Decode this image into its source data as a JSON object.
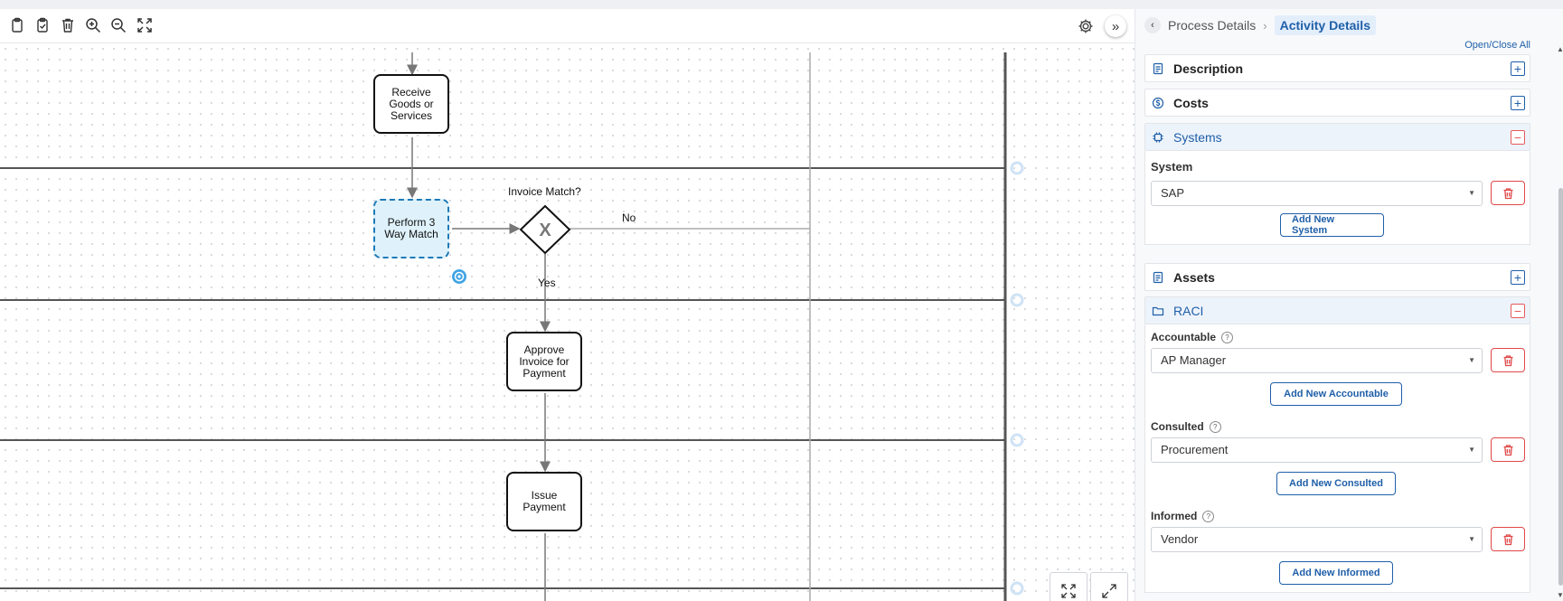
{
  "toolbar": {
    "icons": [
      "clipboard-icon",
      "clipboard-check-icon",
      "trash-icon",
      "zoom-in-icon",
      "zoom-out-icon",
      "fit-screen-icon"
    ]
  },
  "diagram": {
    "tasks": [
      {
        "id": "receive",
        "label": "Receive Goods or Services"
      },
      {
        "id": "match",
        "label": "Perform 3 Way Match",
        "selected": true
      },
      {
        "id": "approve",
        "label": "Approve Invoice for Payment"
      },
      {
        "id": "issue",
        "label": "Issue Payment"
      }
    ],
    "gateway": {
      "label": "Invoice Match?",
      "symbol": "X"
    },
    "flow_labels": {
      "no": "No",
      "yes": "Yes"
    }
  },
  "breadcrumb": {
    "back_symbol": "‹",
    "separator": "›",
    "items": [
      "Process Details",
      "Activity Details"
    ]
  },
  "panel": {
    "open_close": "Open/Close All",
    "sections": {
      "description": {
        "title": "Description",
        "toggle": "+"
      },
      "costs": {
        "title": "Costs",
        "toggle": "+"
      },
      "systems": {
        "title": "Systems",
        "toggle": "−",
        "field_label": "System",
        "value": "SAP",
        "add_label": "Add New System"
      },
      "assets": {
        "title": "Assets",
        "toggle": "+"
      },
      "raci": {
        "title": "RACI",
        "toggle": "−",
        "accountable": {
          "label": "Accountable",
          "value": "AP Manager",
          "add_label": "Add New Accountable"
        },
        "consulted": {
          "label": "Consulted",
          "value": "Procurement",
          "add_label": "Add New Consulted"
        },
        "informed": {
          "label": "Informed",
          "value": "Vendor",
          "add_label": "Add New Informed"
        }
      }
    }
  },
  "colors": {
    "accent": "#1f5fa8",
    "danger": "#e04848",
    "selected_fill": "#dff2fb"
  }
}
